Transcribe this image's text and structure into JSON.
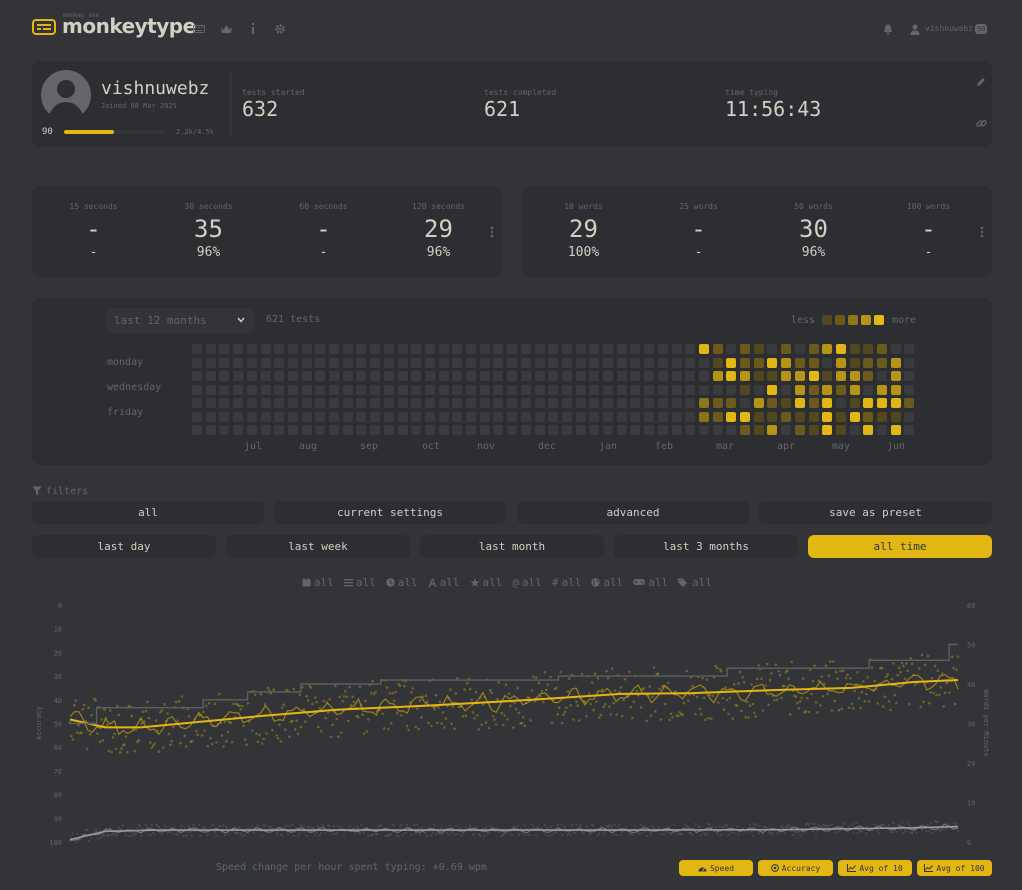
{
  "header": {
    "logo_sup": "monkey see",
    "logo": "monkeytype",
    "username": "vishnuwebz",
    "badge": "90"
  },
  "profile": {
    "name": "vishnuwebz",
    "joined": "Joined 08 Mar 2025",
    "level": "90",
    "xp": "2.2k/4.5k",
    "xp_fraction": 0.49,
    "stats": [
      {
        "label": "tests started",
        "value": "632"
      },
      {
        "label": "tests completed",
        "value": "621"
      },
      {
        "label": "time typing",
        "value": "11:56:43"
      }
    ]
  },
  "pb_time": [
    {
      "label": "15 seconds",
      "wpm": "-",
      "acc": "-"
    },
    {
      "label": "30 seconds",
      "wpm": "35",
      "acc": "96%"
    },
    {
      "label": "60 seconds",
      "wpm": "-",
      "acc": "-"
    },
    {
      "label": "120 seconds",
      "wpm": "29",
      "acc": "96%"
    }
  ],
  "pb_words": [
    {
      "label": "10 words",
      "wpm": "29",
      "acc": "100%"
    },
    {
      "label": "25 words",
      "wpm": "-",
      "acc": "-"
    },
    {
      "label": "50 words",
      "wpm": "30",
      "acc": "96%"
    },
    {
      "label": "100 words",
      "wpm": "-",
      "acc": "-"
    }
  ],
  "activity": {
    "range": "last 12 months",
    "tests": "621 tests",
    "less": "less",
    "more": "more",
    "days": [
      "monday",
      "wednesday",
      "friday"
    ],
    "months": [
      "jul",
      "aug",
      "sep",
      "oct",
      "nov",
      "dec",
      "jan",
      "feb",
      "mar",
      "apr",
      "may",
      "jun"
    ],
    "colors": [
      "#393b3e",
      "#51481f",
      "#6b5a1b",
      "#8c7418",
      "#b69415",
      "#e2b714"
    ]
  },
  "filters": {
    "title": "filters",
    "row1": [
      "all",
      "current settings",
      "advanced",
      "save as preset"
    ],
    "row2": [
      "last day",
      "last week",
      "last month",
      "last 3 months",
      "all time"
    ],
    "active": "all time",
    "chips": [
      {
        "icon": "calendar-icon",
        "label": "all"
      },
      {
        "icon": "list-icon",
        "label": "all"
      },
      {
        "icon": "clock-icon",
        "label": "all"
      },
      {
        "icon": "font-icon",
        "label": "all"
      },
      {
        "icon": "star-icon",
        "label": "all"
      },
      {
        "icon": "at-icon",
        "label": "all"
      },
      {
        "icon": "hashtag-icon",
        "label": "all"
      },
      {
        "icon": "globe-icon",
        "label": "all"
      },
      {
        "icon": "gamepad-icon",
        "label": "all"
      },
      {
        "icon": "tags-icon",
        "label": "all"
      }
    ]
  },
  "chart_data": {
    "type": "line",
    "series": [
      {
        "name": "Speed"
      },
      {
        "name": "Accuracy"
      },
      {
        "name": "Avg of 10"
      },
      {
        "name": "Avg of 100"
      }
    ],
    "y_left": {
      "label": "Accuracy",
      "ticks": [
        "0",
        "10",
        "20",
        "30",
        "40",
        "50",
        "60",
        "70",
        "80",
        "90",
        "100"
      ],
      "range": [
        100,
        0
      ]
    },
    "y_right": {
      "label": "Words per Minute",
      "ticks": [
        "60",
        "50",
        "40",
        "30",
        "20",
        "10",
        "0"
      ],
      "range": [
        0,
        60
      ]
    },
    "pb_steps": [
      [
        0,
        30
      ],
      [
        3,
        34
      ],
      [
        15,
        36
      ],
      [
        20,
        38
      ],
      [
        26,
        40
      ],
      [
        35,
        41
      ],
      [
        55,
        42
      ],
      [
        74,
        44
      ],
      [
        90,
        46
      ],
      [
        99,
        50
      ],
      [
        100,
        50
      ]
    ],
    "avg100_wpm": [
      [
        0,
        31
      ],
      [
        4,
        29
      ],
      [
        8,
        29
      ],
      [
        15,
        30.5
      ],
      [
        22,
        32
      ],
      [
        30,
        33.5
      ],
      [
        40,
        34.5
      ],
      [
        52,
        36
      ],
      [
        62,
        37.5
      ],
      [
        70,
        37.7
      ],
      [
        80,
        38.5
      ],
      [
        88,
        39
      ],
      [
        95,
        40.5
      ],
      [
        100,
        41
      ]
    ],
    "avg100_acc": [
      [
        0,
        99
      ],
      [
        4,
        95.5
      ],
      [
        10,
        95
      ],
      [
        30,
        95
      ],
      [
        60,
        95
      ],
      [
        80,
        94.8
      ],
      [
        95,
        94
      ],
      [
        100,
        93.5
      ]
    ],
    "colors": {
      "main": "#e2b714",
      "sub": "#646669",
      "pb": "#5e5f62"
    }
  },
  "footer": {
    "speed_change": "Speed change per hour spent typing: +0.69 wpm",
    "legend": [
      {
        "icon": "tachometer-icon",
        "label": "Speed"
      },
      {
        "icon": "bullseye-icon",
        "label": "Accuracy"
      },
      {
        "icon": "chart-line-icon",
        "label": "Avg of 10"
      },
      {
        "icon": "chart-line-icon",
        "label": "Avg of 100"
      }
    ]
  }
}
